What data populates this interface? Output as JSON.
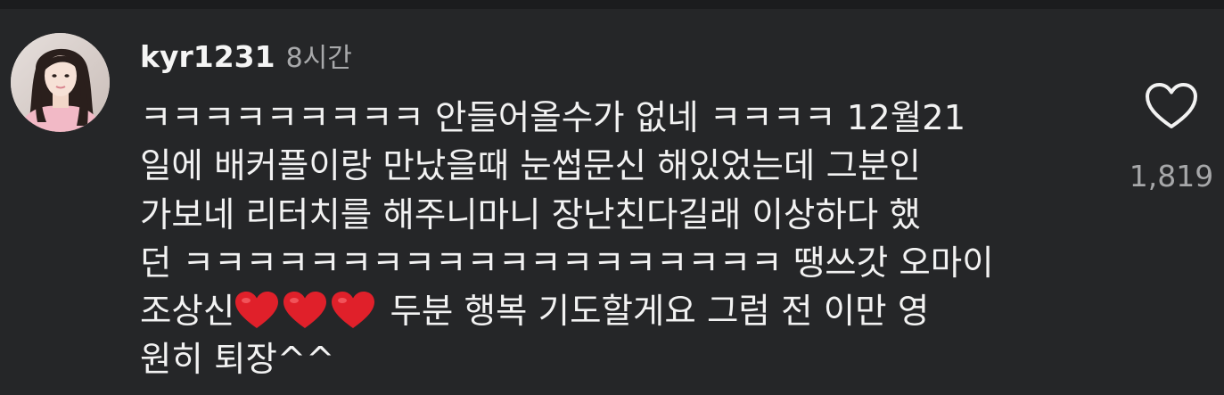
{
  "comment": {
    "username": "kyr1231",
    "timestamp": "8시간",
    "text_before_hearts": "ㅋㅋㅋㅋㅋㅋㅋㅋㅋ 안들어올수가 없네 ㅋㅋㅋㅋ 12월21\n일에 배커플이랑 만났을때 눈썹문신 해있었는데 그분인\n가보네 리터치를 해주니마니 장난친다길래 이상하다 했\n던 ㅋㅋㅋㅋㅋㅋㅋㅋㅋㅋㅋㅋㅋㅋㅋㅋㅋㅋㅋ 땡쓰갓 오마이\n조상신",
    "text_after_hearts": " 두분 행복 기도할게요 그럼 전 이만 영\n원히 퇴장^^",
    "emoji": [
      "heart-emoji",
      "heart-emoji",
      "heart-emoji"
    ],
    "like_icon": "heart-outline-icon",
    "like_count": "1,819"
  },
  "colors": {
    "background": "#252628",
    "text": "#f2f2f2",
    "muted": "#a8a9ab",
    "heart_emoji": "#e0202a"
  }
}
